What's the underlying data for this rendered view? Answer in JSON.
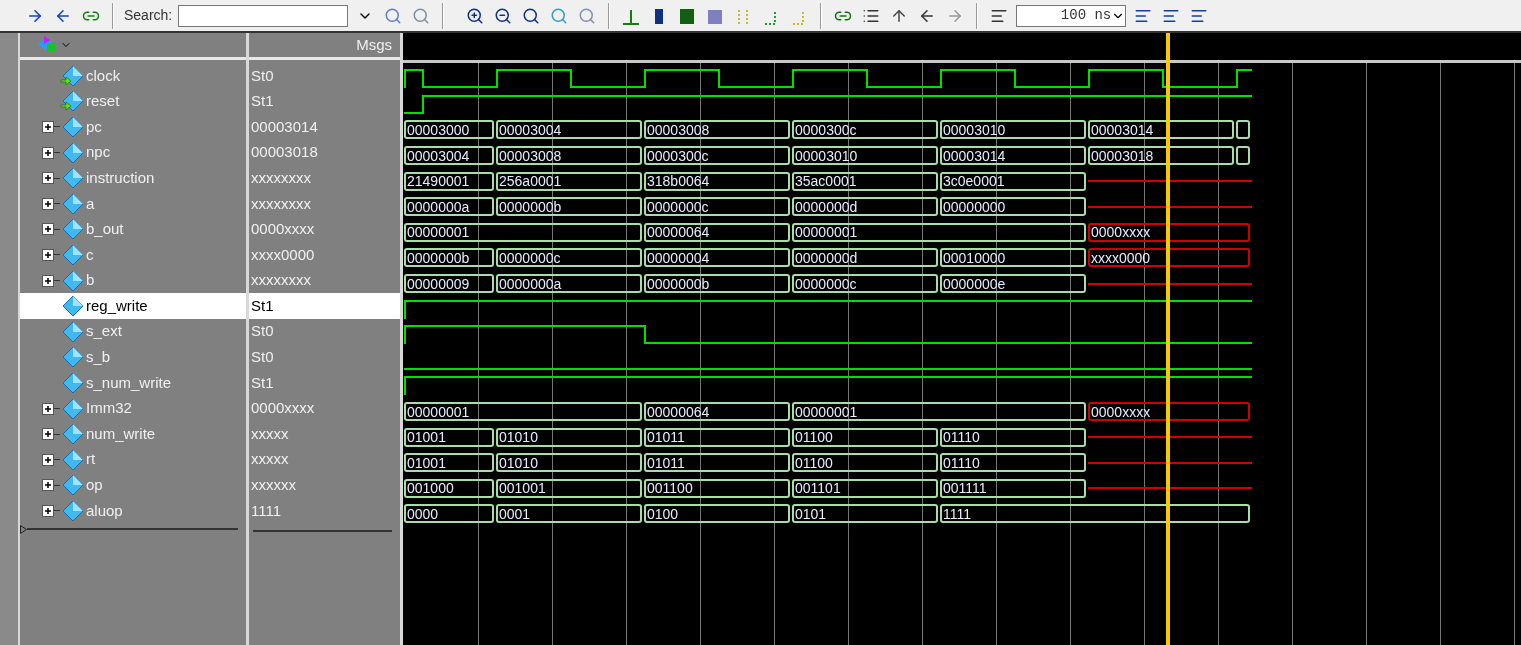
{
  "toolbar": {
    "search": {
      "label": "Search:"
    },
    "time_field": {
      "value": "100 ns"
    }
  },
  "header": {
    "value_column": "Msgs"
  },
  "signals": [
    {
      "name": "clock",
      "value": "St0",
      "kind": "bit",
      "input": true,
      "expandable": false,
      "selected": false,
      "high": [
        true,
        false,
        true,
        false,
        true,
        false,
        true,
        false,
        true,
        false,
        true,
        false,
        true
      ]
    },
    {
      "name": "reset",
      "value": "St1",
      "kind": "bit",
      "input": true,
      "expandable": false,
      "selected": false,
      "high": [
        false,
        true,
        true,
        true,
        true,
        true,
        true,
        true,
        true,
        true,
        true,
        true,
        true
      ]
    },
    {
      "name": "pc",
      "value": "00003014",
      "kind": "bus",
      "input": false,
      "expandable": true,
      "selected": false,
      "slots": [
        {
          "kind": "value",
          "value": "00003000"
        },
        {
          "kind": "value",
          "value": "00003004"
        },
        {
          "kind": "value",
          "value": "00003008"
        },
        {
          "kind": "value",
          "value": "0000300c"
        },
        {
          "kind": "value",
          "value": "00003010"
        },
        {
          "kind": "value",
          "value": "00003014"
        },
        {
          "kind": "blank"
        }
      ]
    },
    {
      "name": "npc",
      "value": "00003018",
      "kind": "bus",
      "input": false,
      "expandable": true,
      "selected": false,
      "slots": [
        {
          "kind": "value",
          "value": "00003004"
        },
        {
          "kind": "value",
          "value": "00003008"
        },
        {
          "kind": "value",
          "value": "0000300c"
        },
        {
          "kind": "value",
          "value": "00003010"
        },
        {
          "kind": "value",
          "value": "00003014"
        },
        {
          "kind": "value",
          "value": "00003018"
        },
        {
          "kind": "blank"
        }
      ]
    },
    {
      "name": "instruction",
      "value": "xxxxxxxx",
      "kind": "bus",
      "input": false,
      "expandable": true,
      "selected": false,
      "slots": [
        {
          "kind": "value",
          "value": "21490001"
        },
        {
          "kind": "value",
          "value": "256a0001"
        },
        {
          "kind": "value",
          "value": "318b0064"
        },
        {
          "kind": "value",
          "value": "35ac0001"
        },
        {
          "kind": "value",
          "value": "3c0e0001"
        },
        {
          "kind": "unknown"
        },
        {
          "kind": "hold"
        }
      ]
    },
    {
      "name": "a",
      "value": "xxxxxxxx",
      "kind": "bus",
      "input": false,
      "expandable": true,
      "selected": false,
      "slots": [
        {
          "kind": "value",
          "value": "0000000a"
        },
        {
          "kind": "value",
          "value": "0000000b"
        },
        {
          "kind": "value",
          "value": "0000000c"
        },
        {
          "kind": "value",
          "value": "0000000d"
        },
        {
          "kind": "value",
          "value": "00000000"
        },
        {
          "kind": "unknown"
        },
        {
          "kind": "hold"
        }
      ]
    },
    {
      "name": "b_out",
      "value": "0000xxxx",
      "kind": "bus",
      "input": false,
      "expandable": true,
      "selected": false,
      "slots": [
        {
          "kind": "value",
          "value": "00000001"
        },
        {
          "kind": "hold"
        },
        {
          "kind": "value",
          "value": "00000064"
        },
        {
          "kind": "value",
          "value": "00000001"
        },
        {
          "kind": "hold"
        },
        {
          "kind": "partial",
          "value": "0000xxxx"
        },
        {
          "kind": "hold"
        }
      ]
    },
    {
      "name": "c",
      "value": "xxxx0000",
      "kind": "bus",
      "input": false,
      "expandable": true,
      "selected": false,
      "slots": [
        {
          "kind": "value",
          "value": "0000000b"
        },
        {
          "kind": "value",
          "value": "0000000c"
        },
        {
          "kind": "value",
          "value": "00000004"
        },
        {
          "kind": "value",
          "value": "0000000d"
        },
        {
          "kind": "value",
          "value": "00010000"
        },
        {
          "kind": "partial",
          "value": "xxxx0000"
        },
        {
          "kind": "hold"
        }
      ]
    },
    {
      "name": "b",
      "value": "xxxxxxxx",
      "kind": "bus",
      "input": false,
      "expandable": true,
      "selected": false,
      "slots": [
        {
          "kind": "value",
          "value": "00000009"
        },
        {
          "kind": "value",
          "value": "0000000a"
        },
        {
          "kind": "value",
          "value": "0000000b"
        },
        {
          "kind": "value",
          "value": "0000000c"
        },
        {
          "kind": "value",
          "value": "0000000e"
        },
        {
          "kind": "unknown"
        },
        {
          "kind": "hold"
        }
      ]
    },
    {
      "name": "reg_write",
      "value": "St1",
      "kind": "bit",
      "input": false,
      "expandable": false,
      "selected": true,
      "high": [
        true,
        true,
        true,
        true,
        true,
        true,
        true,
        true,
        true,
        true,
        true,
        true,
        true
      ]
    },
    {
      "name": "s_ext",
      "value": "St0",
      "kind": "bit",
      "input": false,
      "expandable": false,
      "selected": false,
      "high": [
        true,
        true,
        true,
        true,
        false,
        false,
        false,
        false,
        false,
        false,
        false,
        false,
        false
      ]
    },
    {
      "name": "s_b",
      "value": "St0",
      "kind": "bit",
      "input": false,
      "expandable": false,
      "selected": false,
      "high": [
        false,
        false,
        false,
        false,
        false,
        false,
        false,
        false,
        false,
        false,
        false,
        false,
        false
      ]
    },
    {
      "name": "s_num_write",
      "value": "St1",
      "kind": "bit",
      "input": false,
      "expandable": false,
      "selected": false,
      "high": [
        true,
        true,
        true,
        true,
        true,
        true,
        true,
        true,
        true,
        true,
        true,
        true,
        true
      ]
    },
    {
      "name": "Imm32",
      "value": "0000xxxx",
      "kind": "bus",
      "input": false,
      "expandable": true,
      "selected": false,
      "slots": [
        {
          "kind": "value",
          "value": "00000001"
        },
        {
          "kind": "hold"
        },
        {
          "kind": "value",
          "value": "00000064"
        },
        {
          "kind": "value",
          "value": "00000001"
        },
        {
          "kind": "hold"
        },
        {
          "kind": "partial",
          "value": "0000xxxx"
        },
        {
          "kind": "hold"
        }
      ]
    },
    {
      "name": "num_write",
      "value": "xxxxx",
      "kind": "bus",
      "input": false,
      "expandable": true,
      "selected": false,
      "slots": [
        {
          "kind": "value",
          "value": "01001"
        },
        {
          "kind": "value",
          "value": "01010"
        },
        {
          "kind": "value",
          "value": "01011"
        },
        {
          "kind": "value",
          "value": "01100"
        },
        {
          "kind": "value",
          "value": "01110"
        },
        {
          "kind": "unknown"
        },
        {
          "kind": "hold"
        }
      ]
    },
    {
      "name": "rt",
      "value": "xxxxx",
      "kind": "bus",
      "input": false,
      "expandable": true,
      "selected": false,
      "slots": [
        {
          "kind": "value",
          "value": "01001"
        },
        {
          "kind": "value",
          "value": "01010"
        },
        {
          "kind": "value",
          "value": "01011"
        },
        {
          "kind": "value",
          "value": "01100"
        },
        {
          "kind": "value",
          "value": "01110"
        },
        {
          "kind": "unknown"
        },
        {
          "kind": "hold"
        }
      ]
    },
    {
      "name": "op",
      "value": "xxxxxx",
      "kind": "bus",
      "input": false,
      "expandable": true,
      "selected": false,
      "slots": [
        {
          "kind": "value",
          "value": "001000"
        },
        {
          "kind": "value",
          "value": "001001"
        },
        {
          "kind": "value",
          "value": "001100"
        },
        {
          "kind": "value",
          "value": "001101"
        },
        {
          "kind": "value",
          "value": "001111"
        },
        {
          "kind": "unknown"
        },
        {
          "kind": "hold"
        }
      ]
    },
    {
      "name": "aluop",
      "value": "1111",
      "kind": "bus",
      "input": false,
      "expandable": true,
      "selected": false,
      "slots": [
        {
          "kind": "value",
          "value": "0000"
        },
        {
          "kind": "value",
          "value": "0001"
        },
        {
          "kind": "value",
          "value": "0100"
        },
        {
          "kind": "value",
          "value": "0101"
        },
        {
          "kind": "value",
          "value": "1111"
        },
        {
          "kind": "hold"
        },
        {
          "kind": "hold"
        }
      ]
    }
  ]
}
